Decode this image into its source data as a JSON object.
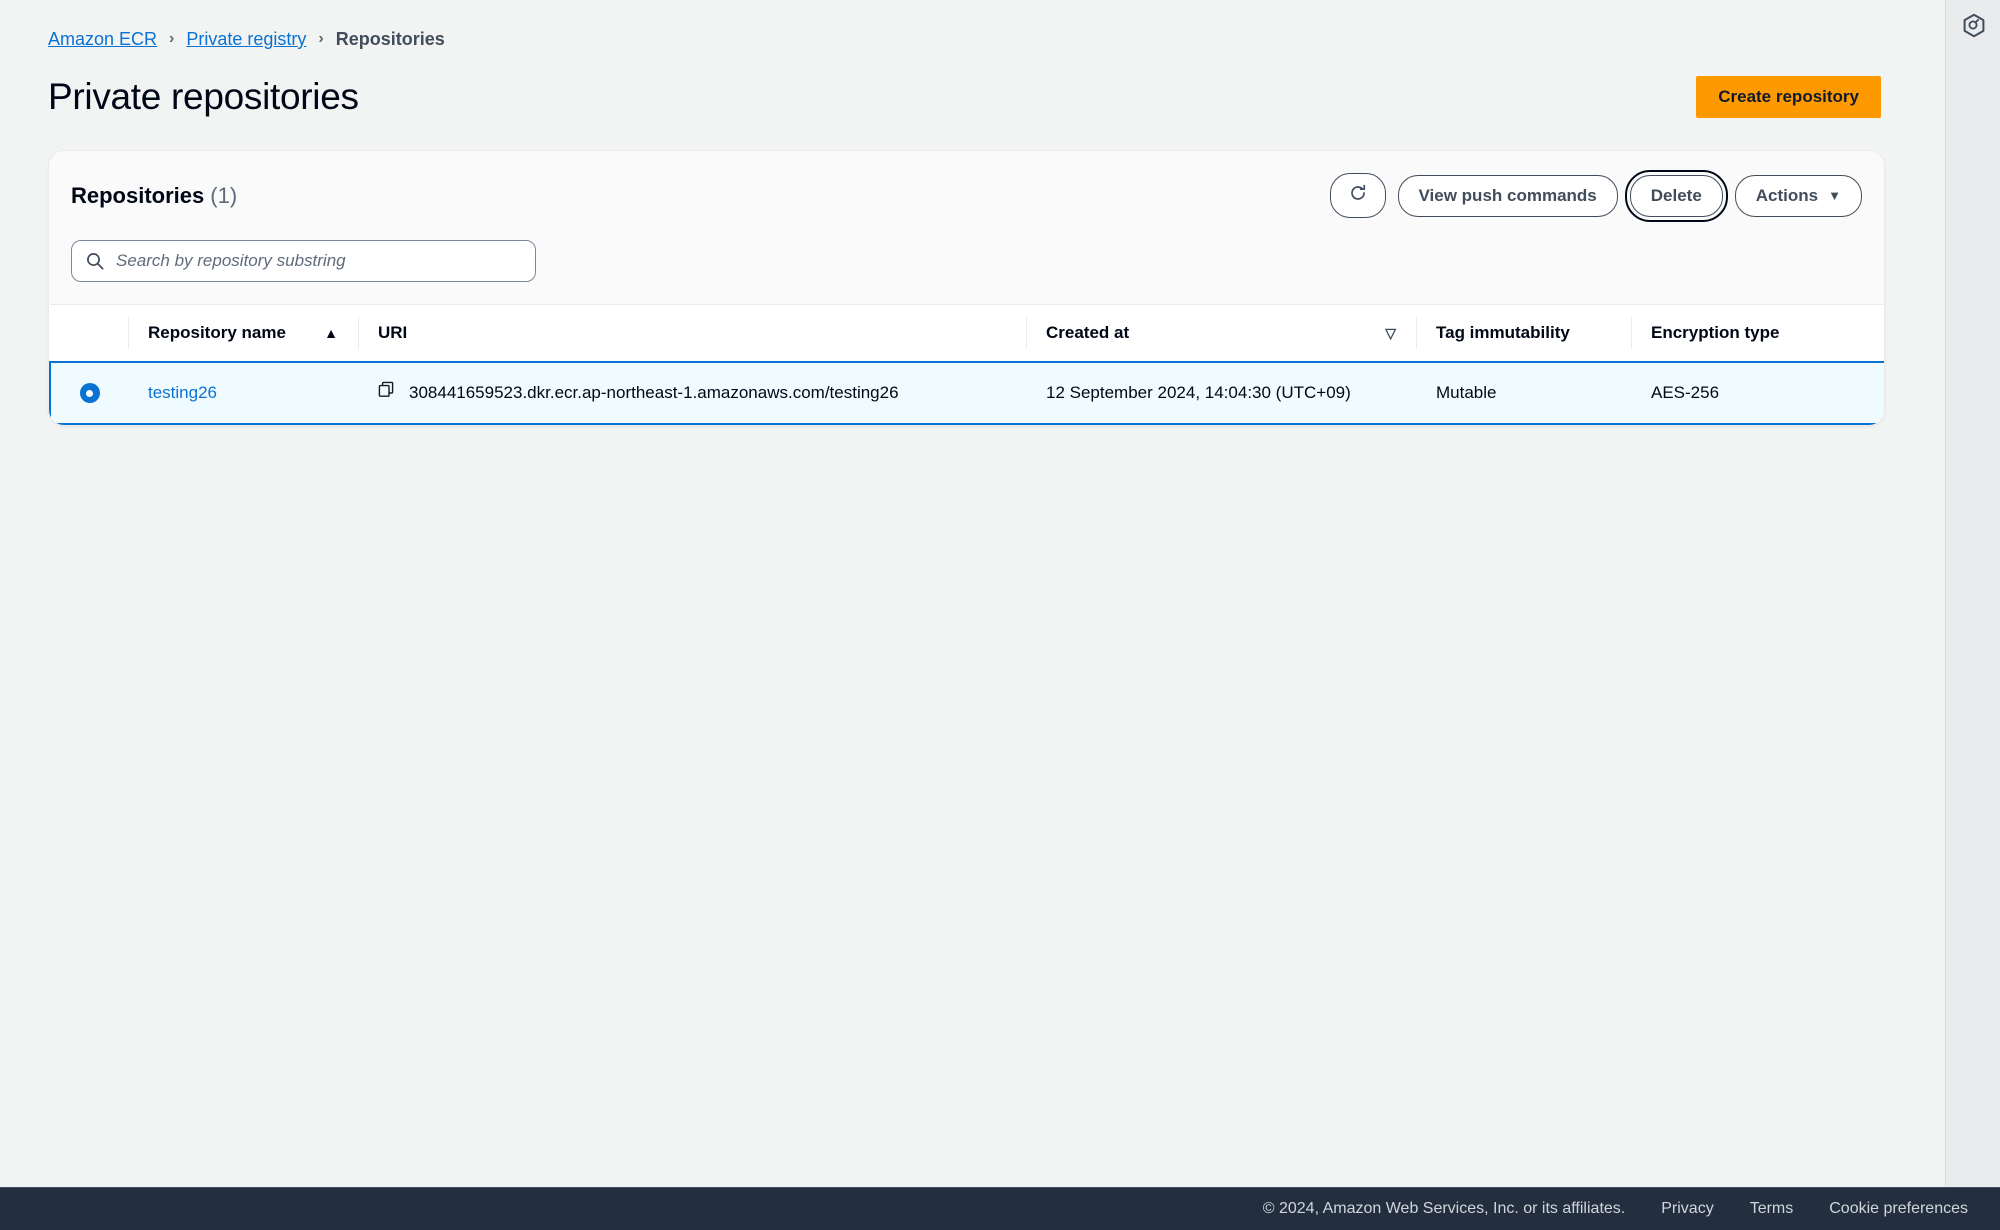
{
  "breadcrumb": {
    "items": [
      {
        "label": "Amazon ECR",
        "link": true
      },
      {
        "label": "Private registry",
        "link": true
      },
      {
        "label": "Repositories",
        "link": false
      }
    ],
    "separator": "›"
  },
  "page": {
    "title": "Private repositories",
    "create_button": "Create repository"
  },
  "card": {
    "heading": "Repositories",
    "count": "(1)",
    "toolbar": {
      "refresh_icon": "refresh-icon",
      "view_push_commands": "View push commands",
      "delete": "Delete",
      "actions": "Actions",
      "actions_caret": "▼"
    },
    "search": {
      "placeholder": "Search by repository substring",
      "value": "",
      "icon": "search-icon"
    }
  },
  "table": {
    "columns": [
      {
        "key": "name",
        "label": "Repository name",
        "sort": "asc",
        "sort_glyph": "▲"
      },
      {
        "key": "uri",
        "label": "URI",
        "sort": "none",
        "sort_glyph": ""
      },
      {
        "key": "created",
        "label": "Created at",
        "sort": "desc-inactive",
        "sort_glyph": "▽"
      },
      {
        "key": "tag",
        "label": "Tag immutability",
        "sort": "none",
        "sort_glyph": ""
      },
      {
        "key": "encryption",
        "label": "Encryption type",
        "sort": "none",
        "sort_glyph": ""
      }
    ],
    "rows": [
      {
        "selected": true,
        "name": "testing26",
        "uri": "308441659523.dkr.ecr.ap-northeast-1.amazonaws.com/testing26",
        "copy_icon": "copy-icon",
        "created": "12 September 2024, 14:04:30 (UTC+09)",
        "tag": "Mutable",
        "encryption": "AES-256"
      }
    ]
  },
  "right_panel": {
    "icon": "hexagon-annotation-icon"
  },
  "footer": {
    "copyright": "© 2024, Amazon Web Services, Inc. or its affiliates.",
    "links": [
      "Privacy",
      "Terms",
      "Cookie preferences"
    ]
  },
  "colors": {
    "accent_orange": "#ff9900",
    "link_blue": "#0972d3",
    "footer_bg": "#232f3e",
    "page_bg": "#f2f3f3",
    "selected_row_bg": "#f0fbff"
  }
}
